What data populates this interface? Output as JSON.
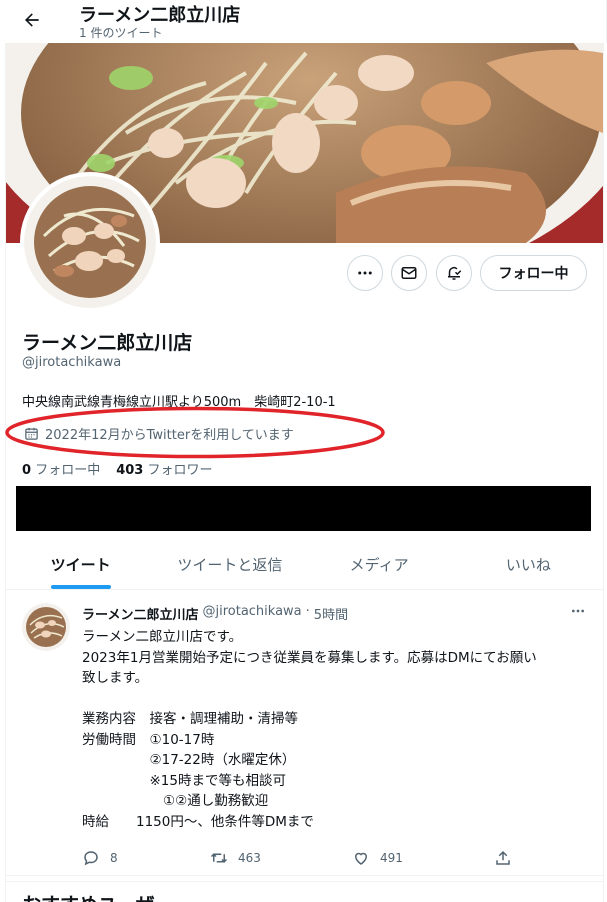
{
  "header": {
    "title": "ラーメン二郎立川店",
    "subtitle": "1 件のツイート",
    "back_icon": "arrow-left-icon"
  },
  "profile": {
    "display_name": "ラーメン二郎立川店",
    "handle": "@jirotachikawa",
    "bio": "中央線南武線青梅線立川駅より500m　柴崎町2-10-1",
    "joined": "2022年12月からTwitterを利用しています",
    "following_count": "0",
    "following_label": "フォロー中",
    "followers_count": "403",
    "followers_label": "フォロワー",
    "follow_button_label": "フォロー中",
    "annotation_color": "#e0242a"
  },
  "tabs": [
    {
      "label": "ツイート",
      "active": true
    },
    {
      "label": "ツイートと返信",
      "active": false
    },
    {
      "label": "メディア",
      "active": false
    },
    {
      "label": "いいね",
      "active": false
    }
  ],
  "tweet": {
    "author": "ラーメン二郎立川店",
    "handle": "@jirotachikawa",
    "separator": "·",
    "time": "5時間",
    "lines": [
      "ラーメン二郎立川店です。",
      "2023年1月営業開始予定につき従業員を募集します。応募はDMにてお願い",
      "致します。",
      "",
      "業務内容　接客・調理補助・清掃等",
      "労働時間　①10-17時",
      "　　　　　②17-22時（水曜定休）",
      "　　　　　※15時まで等も相談可",
      "　　　　　　①②通し勤務歓迎",
      "時給　　1150円〜、他条件等DMまで"
    ],
    "replies": "8",
    "retweets": "463",
    "likes": "491"
  },
  "recommendations": {
    "title": "おすすめユーザー"
  },
  "colors": {
    "accent": "#1d9bf0",
    "text_primary": "#0f1419",
    "text_secondary": "#536471"
  }
}
